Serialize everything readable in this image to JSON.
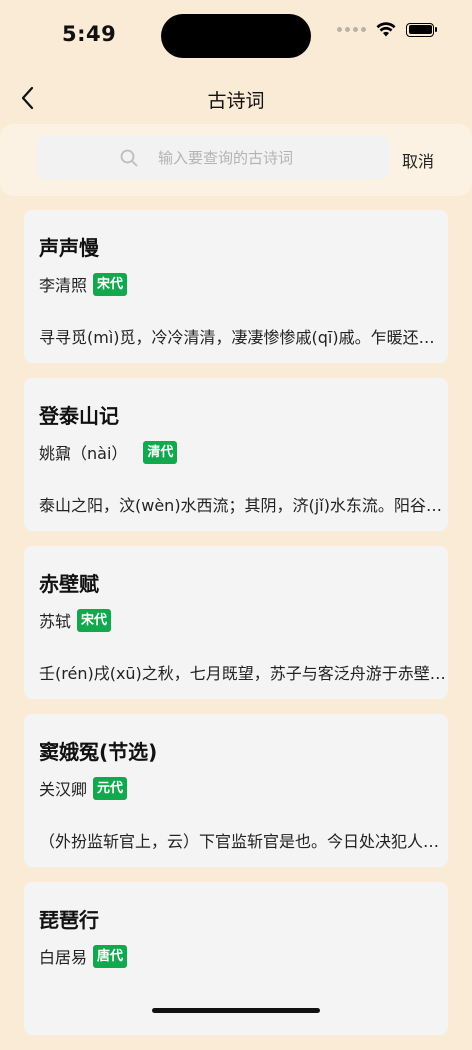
{
  "status_bar": {
    "time": "5:49"
  },
  "nav": {
    "title": "古诗词"
  },
  "search": {
    "placeholder": "输入要查询的古诗词",
    "value": "",
    "cancel_label": "取消"
  },
  "poems": [
    {
      "title": "声声慢",
      "author": "李清照",
      "dynasty": "宋代",
      "excerpt": "寻寻觅(mì)觅，冷冷清清，凄凄惨惨戚(qī)戚。乍暖还寒时候，最难将息。"
    },
    {
      "title": "登泰山记",
      "author": "姚鼐（nài）",
      "dynasty": "清代",
      "excerpt": "泰山之阳，汶(wèn)水西流；其阴，济(jǐ)水东流。阳谷皆入汶，阴谷皆入济。"
    },
    {
      "title": "赤壁赋",
      "author": "苏轼",
      "dynasty": "宋代",
      "excerpt": "壬(rén)戌(xū)之秋，七月既望，苏子与客泛舟游于赤壁之下。"
    },
    {
      "title": "窦娥冤(节选)",
      "author": "关汉卿",
      "dynasty": "元代",
      "excerpt": "（外扮监斩官上，云）下官监斩官是也。今日处决犯人，着做公的把住巷口。"
    },
    {
      "title": "琵琶行",
      "author": "白居易",
      "dynasty": "唐代",
      "excerpt": ""
    }
  ],
  "colors": {
    "background": "#faebd6",
    "card": "#f4f4f4",
    "badge": "#11a84e"
  },
  "icons": {
    "back": "chevron-left-icon",
    "search": "search-icon"
  }
}
